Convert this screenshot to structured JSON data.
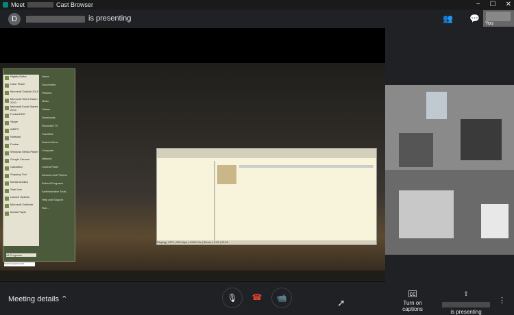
{
  "window": {
    "title": "Meet",
    "title_suffix": "Cast Browser",
    "min": "−",
    "max": "☐",
    "close": "✕"
  },
  "header": {
    "avatar_letter": "D",
    "presenting_text": "is presenting"
  },
  "you_tile": {
    "label": "You"
  },
  "bottom": {
    "meeting_details": "Meeting details",
    "captions_label": "Turn on captions",
    "present_label": "is presenting"
  },
  "icons": {
    "people": "people-icon",
    "chat": "chat-icon",
    "mic": "mic-icon",
    "hangup": "hangup-icon",
    "camera": "camera-icon",
    "captions": "cc-icon",
    "present": "present-icon",
    "more": "more-vert-icon"
  },
  "shared_screen": {
    "start_menu_left": [
      "Nightly Editor",
      "Color Picker",
      "Microsoft Outlook 2010",
      "Microsoft Word Starter 2010",
      "Microsoft Excel Starter 2010",
      "Foobar2000",
      "Skype",
      "AIMP3",
      "Notepad",
      "Foobar",
      "Windows Media Player",
      "Google Chrome",
      "Calculator",
      "Snipping Tool",
      "Media Monkey",
      "Start Icon",
      "Launch Options",
      "Microsoft OneNote",
      "Media Player"
    ],
    "start_menu_right": [
      "Home",
      "Documents",
      "Pictures",
      "Music",
      "Videos",
      "Downloads",
      "Recorded TV",
      "Favorites",
      "Search Items",
      "Computer",
      "Network",
      "Control Panel",
      "Devices and Printers",
      "Default Programs",
      "Administrative Tools",
      "Help and Support",
      "Run..."
    ],
    "all_programs": "All Programs",
    "search_placeholder": "Search programs and...",
    "player_status": "Playing | MP3 | 320 kbps | 44100 Hz | Stereo | 5:48 | 20.28"
  }
}
